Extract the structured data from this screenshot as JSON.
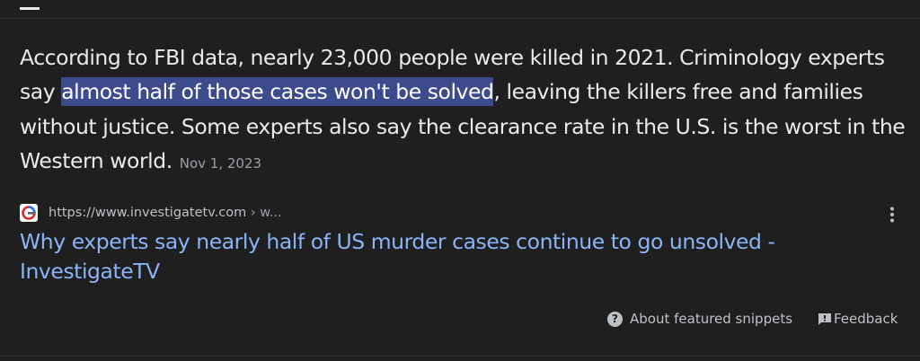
{
  "snippet": {
    "text_before": "According to FBI data, nearly 23,000 people were killed in 2021. Criminology experts say ",
    "highlight": "almost half of those cases won't be solved",
    "text_after": ", leaving the killers free and families without justice. Some experts also say the clearance rate in the U.S. is the worst in the Western world.",
    "date": "Nov 1, 2023"
  },
  "source": {
    "url": "https://www.investigatetv.com",
    "url_path": " › w...",
    "favicon": "investigatetv-logo"
  },
  "result": {
    "title": "Why experts say nearly half of US murder cases continue to go unsolved - InvestigateTV"
  },
  "footer": {
    "about_label": "About featured snippets",
    "feedback_label": "Feedback"
  },
  "icons": {
    "more": "more-vert-icon",
    "about": "question-circle-icon",
    "feedback": "feedback-icon"
  },
  "colors": {
    "background": "#1f1f1f",
    "highlight": "#3c4b8c",
    "link": "#8ab4f8",
    "text": "#e8eaed",
    "muted": "#9aa0a6"
  }
}
